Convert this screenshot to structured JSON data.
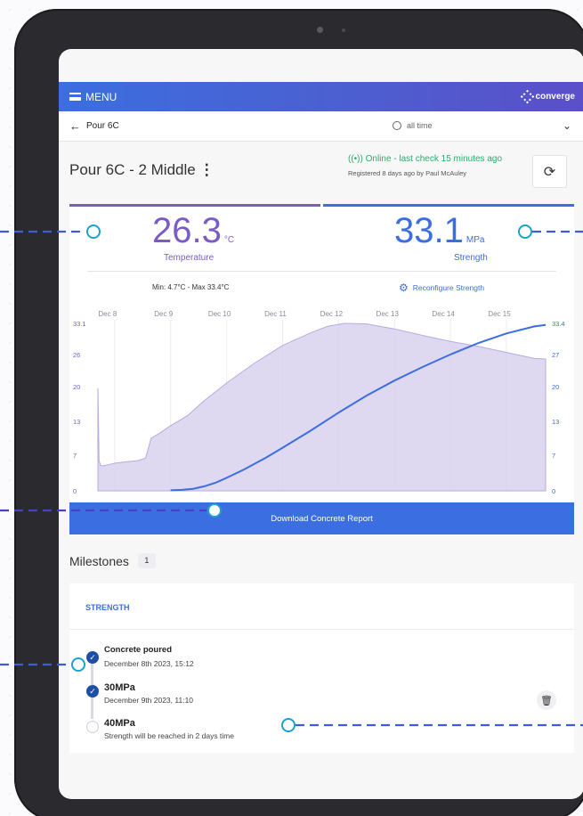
{
  "topbar": {
    "menu_label": "MENU",
    "brand": "converge"
  },
  "breadcrumb": {
    "back_label": "Pour 6C",
    "time_filter": "all time"
  },
  "pour": {
    "title": "Pour 6C - 2 Middle",
    "status": "((•)) Online - last check 15 minutes ago",
    "registered": "Registered 8 days ago by Paul McAuley"
  },
  "metrics": {
    "temperature": {
      "value": "26.3",
      "unit": "°C",
      "label": "Temperature",
      "minmax": "Min: 4.7°C - Max 33.4°C"
    },
    "strength": {
      "value": "33.1",
      "unit": "MPa",
      "label": "Strength"
    },
    "reconfigure_label": "Reconfigure Strength"
  },
  "download_label": "Download Concrete Report",
  "milestones": {
    "title": "Milestones",
    "count": "1",
    "section": "STRENGTH",
    "items": [
      {
        "name": "Concrete poured",
        "detail": "December 8th 2023, 15:12",
        "done": true
      },
      {
        "name": "30MPa",
        "detail": "December 9th 2023, 11:10",
        "done": true
      },
      {
        "name": "40MPa",
        "detail": "Strength will be reached in 2 days time",
        "done": false
      }
    ]
  },
  "colors": {
    "temperature": "#7b5cc4",
    "strength": "#3b6ee0",
    "online": "#2eaa6a",
    "callout": "#1aa3c9"
  },
  "chart_data": {
    "type": "area",
    "x_ticks": [
      "Dec 8",
      "Dec 9",
      "Dec 10",
      "Dec 11",
      "Dec 12",
      "Dec 13",
      "Dec 14",
      "Dec 15"
    ],
    "y_left_ticks": [
      "33.1",
      "26",
      "20",
      "13",
      "7",
      "0"
    ],
    "y_right_ticks": [
      "33.4",
      "27",
      "20",
      "13",
      "7",
      "0"
    ],
    "ylim": [
      0,
      33.4
    ],
    "xlim": [
      7.7,
      15.7
    ],
    "series": [
      {
        "name": "Temperature",
        "style": "area",
        "x": [
          7.7,
          7.72,
          7.75,
          7.8,
          8.0,
          8.2,
          8.4,
          8.55,
          8.6,
          8.65,
          8.8,
          9.0,
          9.3,
          9.6,
          10.0,
          10.5,
          11.0,
          11.5,
          11.8,
          12.1,
          12.5,
          13.0,
          13.5,
          14.0,
          14.5,
          15.0,
          15.5,
          15.7
        ],
        "y": [
          20.5,
          6.0,
          5.0,
          5.0,
          5.5,
          5.8,
          6.0,
          6.5,
          8.5,
          10.5,
          11.5,
          13.0,
          15.0,
          18.0,
          21.5,
          25.5,
          29.0,
          31.5,
          32.8,
          33.4,
          33.3,
          32.3,
          31.0,
          29.8,
          28.8,
          27.6,
          26.4,
          26.3
        ]
      },
      {
        "name": "Strength",
        "style": "line",
        "x": [
          9.0,
          9.2,
          9.4,
          9.6,
          9.8,
          10.0,
          10.3,
          10.7,
          11.0,
          11.5,
          12.0,
          12.5,
          13.0,
          13.5,
          14.0,
          14.5,
          15.0,
          15.5,
          15.7
        ],
        "y": [
          0.1,
          0.2,
          0.4,
          0.9,
          1.6,
          2.6,
          4.2,
          6.6,
          8.6,
          12.0,
          15.6,
          19.0,
          22.0,
          24.7,
          27.2,
          29.5,
          31.4,
          32.8,
          33.1
        ]
      }
    ]
  }
}
